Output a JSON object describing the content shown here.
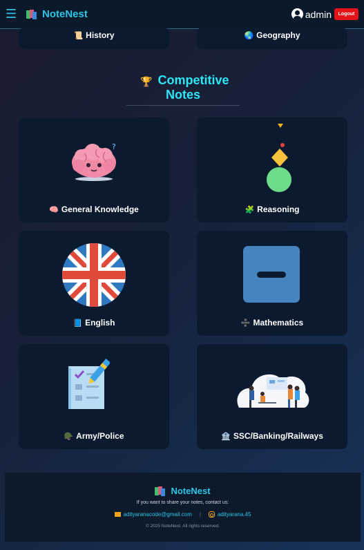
{
  "navbar": {
    "menu_icon": "hamburger-menu-icon",
    "brand": "NoteNest",
    "user_icon": "user-circle-icon",
    "username": "admin",
    "logout_label": "Logout"
  },
  "school_notes": [
    {
      "label": "History",
      "icon": "scroll-icon",
      "emoji": "📜"
    },
    {
      "label": "Geography",
      "icon": "globe-icon",
      "emoji": "🌏"
    }
  ],
  "competitive": {
    "title_line1": "Competitive",
    "title_line2": "Notes",
    "trophy_icon": "🏆",
    "cards": [
      {
        "label": "General Knowledge",
        "icon": "brain-icon",
        "emoji": "🧠"
      },
      {
        "label": "Reasoning",
        "icon": "puzzle-icon",
        "emoji": "🧩"
      },
      {
        "label": "English",
        "icon": "book-icon",
        "emoji": "📘"
      },
      {
        "label": "Mathematics",
        "icon": "divide-icon",
        "emoji": "➗"
      },
      {
        "label": "Army/Police",
        "icon": "helmet-icon",
        "emoji": "🪖"
      },
      {
        "label": "SSC/Banking/Railways",
        "icon": "bank-icon",
        "emoji": "🏦"
      }
    ]
  },
  "footer": {
    "brand": "NoteNest",
    "text": "If you want to share your notes, contact us:",
    "email": "adityaranacode@gmail.com",
    "separator": "|",
    "instagram": "adityarana.45",
    "copyright": "© 2025 NoteNest. All rights reserved."
  },
  "colors": {
    "accent": "#2ec4e6",
    "logout": "#e51217",
    "card_bg": "#0c1a30",
    "title": "#2ee6f5"
  }
}
